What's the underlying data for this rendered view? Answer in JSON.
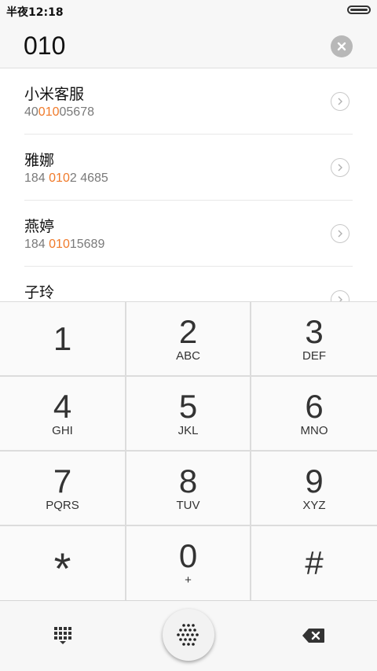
{
  "status_bar": {
    "time": "半夜12:18"
  },
  "search": {
    "query": "010"
  },
  "results": [
    {
      "name": "小米客服",
      "num_pre": "40",
      "num_hl": "010",
      "num_post": "05678"
    },
    {
      "name": "雅娜",
      "num_pre": "184 ",
      "num_hl": "010",
      "num_post": "2 4685"
    },
    {
      "name": "燕婷",
      "num_pre": "184 ",
      "num_hl": "010",
      "num_post": "15689"
    },
    {
      "name": "子玲",
      "num_pre": "",
      "num_hl": "",
      "num_post": ""
    }
  ],
  "keypad": {
    "k1": {
      "digit": "1",
      "letters": ""
    },
    "k2": {
      "digit": "2",
      "letters": "ABC"
    },
    "k3": {
      "digit": "3",
      "letters": "DEF"
    },
    "k4": {
      "digit": "4",
      "letters": "GHI"
    },
    "k5": {
      "digit": "5",
      "letters": "JKL"
    },
    "k6": {
      "digit": "6",
      "letters": "MNO"
    },
    "k7": {
      "digit": "7",
      "letters": "PQRS"
    },
    "k8": {
      "digit": "8",
      "letters": "TUV"
    },
    "k9": {
      "digit": "9",
      "letters": "XYZ"
    },
    "kstar": {
      "digit": "*",
      "letters": ""
    },
    "k0": {
      "digit": "0",
      "letters": "+"
    },
    "khash": {
      "digit": "#",
      "letters": ""
    }
  },
  "colors": {
    "highlight": "#f07a2a",
    "background": "#f7f7f7",
    "divider": "#dcdcdc"
  },
  "icons": {
    "clear": "clear-icon",
    "detail": "chevron-right-icon",
    "dialpad": "dialpad-icon",
    "call": "call-icon",
    "backspace": "backspace-icon"
  }
}
